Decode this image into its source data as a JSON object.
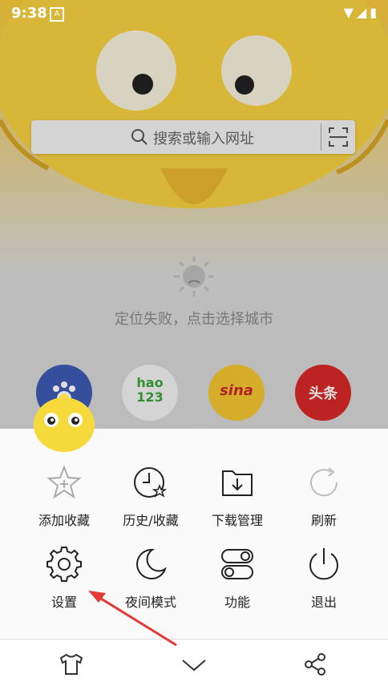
{
  "status": {
    "time": "9:38",
    "notif_glyph": "A"
  },
  "search": {
    "placeholder": "搜索或输入网址"
  },
  "weather": {
    "message": "定位失败，点击选择城市"
  },
  "apps": [
    {
      "label": "hao\n123",
      "name": "app-hao123"
    },
    {
      "label": "sina",
      "name": "app-sina"
    },
    {
      "label": "头条",
      "name": "app-toutiao"
    }
  ],
  "menu": {
    "items": [
      {
        "label": "添加收藏",
        "icon": "star-add-icon"
      },
      {
        "label": "历史/收藏",
        "icon": "history-icon"
      },
      {
        "label": "下载管理",
        "icon": "download-icon"
      },
      {
        "label": "刷新",
        "icon": "refresh-icon"
      },
      {
        "label": "设置",
        "icon": "gear-icon"
      },
      {
        "label": "夜间模式",
        "icon": "moon-icon"
      },
      {
        "label": "功能",
        "icon": "toggle-icon"
      },
      {
        "label": "退出",
        "icon": "power-icon"
      }
    ]
  },
  "bottom": {
    "icons": [
      "shirt-icon",
      "chevron-down-icon",
      "share-icon"
    ]
  },
  "colors": {
    "accent": "#e53935",
    "sina_bg": "#f3c531",
    "toutiao_bg": "#d72a2a",
    "mascot": "#f6d040"
  }
}
